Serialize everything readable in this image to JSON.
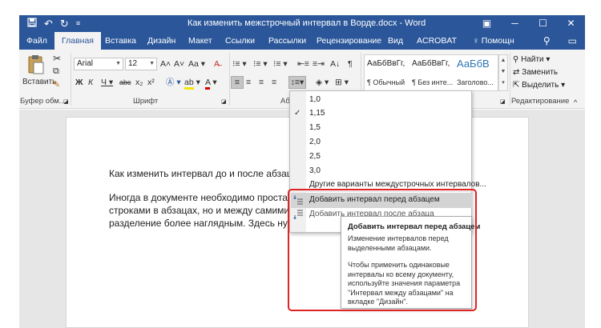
{
  "titlebar": {
    "title": "Как изменить межстрочный интервал в Ворде.docx - Word",
    "qat": {
      "save_icon": "save-icon",
      "undo_icon": "undo-icon",
      "redo_icon": "redo-icon",
      "customize_icon": "customize-qat-icon"
    },
    "window_buttons": [
      "ribbon-display-icon",
      "minimize-icon",
      "maximize-icon",
      "close-icon"
    ]
  },
  "tabs": [
    {
      "label": "Файл"
    },
    {
      "label": "Главная",
      "active": true
    },
    {
      "label": "Вставка"
    },
    {
      "label": "Дизайн"
    },
    {
      "label": "Макет"
    },
    {
      "label": "Ссылки"
    },
    {
      "label": "Рассылки"
    },
    {
      "label": "Рецензирование"
    },
    {
      "label": "Вид"
    },
    {
      "label": "ACROBAT"
    }
  ],
  "tell_me": "♀ Помощн",
  "ribbon": {
    "clipboard": {
      "paste_label": "Вставить",
      "group_label": "Буфер обм..."
    },
    "font": {
      "font_name": "Arial",
      "font_size": "12",
      "case_label": "Aa",
      "group_label": "Шрифт"
    },
    "paragraph": {
      "group_label": "Аб"
    },
    "styles": [
      {
        "sample": "АаБбВвГг,",
        "name": "¶ Обычный"
      },
      {
        "sample": "АаБбВвГг,",
        "name": "¶ Без инте..."
      },
      {
        "sample": "АаБбВ",
        "name": "Заголово..."
      }
    ],
    "editing": {
      "find": "Найти",
      "replace": "Заменить",
      "select": "Выделить",
      "group_label": "Редактирование"
    }
  },
  "document": {
    "heading": "Как изменить интервал до и после абзаце",
    "lines": [
      "Иногда в документе необходимо простав",
      "строками в абзацах, но и между самими",
      "разделение более наглядным. Здесь нужно действов"
    ]
  },
  "spacing_menu": {
    "values": [
      "1,0",
      "1,15",
      "1,5",
      "2,0",
      "2,5",
      "3,0"
    ],
    "checked": "1,15",
    "more_options": "Другие варианты междустрочных интервалов...",
    "add_before": "Добавить интервал перед абзацем",
    "add_after": "Добавить интервал после абзаца"
  },
  "tooltip": {
    "title": "Добавить интервал перед абзацем",
    "description": "Изменение интервалов перед выделенными абзацами.",
    "hint": "Чтобы применить одинаковые интервалы ко всему документу, используйте значения параметра \"Интервал между абзацами\" на вкладке \"Дизайн\"."
  },
  "colors": {
    "accent": "#2b579a",
    "highlight_box": "#e02323"
  }
}
